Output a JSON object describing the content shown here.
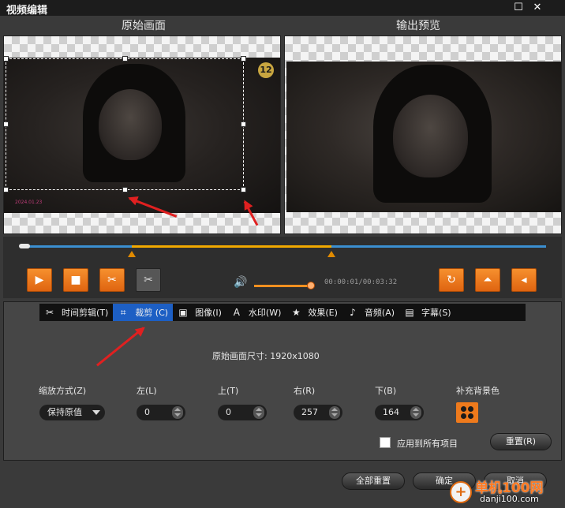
{
  "window": {
    "title": "视频编辑",
    "controls": {
      "maximize": "☐",
      "close": "✕"
    }
  },
  "viewers": {
    "source_label": "原始画面",
    "output_label": "输出预览",
    "badge_text": "12",
    "watermark_text": "2024.01.23"
  },
  "playback": {
    "time_display": "00:00:01/00:03:32",
    "volume_fraction": 0.95,
    "position_fraction": 0.0,
    "segment_start_fraction": 0.21,
    "segment_end_fraction": 0.59,
    "icons": {
      "play": "▶",
      "stop": "■",
      "cut": "✂",
      "cut_disabled": "✂",
      "rotate": "↻",
      "flip_horizontal": "⏶",
      "flip_vertical": "◂",
      "volume": "🔊"
    }
  },
  "tabs": [
    {
      "icon": "✂",
      "label": "时间剪辑(T)",
      "active": false
    },
    {
      "icon": "⌗",
      "label": "裁剪 (C)",
      "active": true
    },
    {
      "icon": "▣",
      "label": "图像(I)",
      "active": false
    },
    {
      "icon": "A",
      "label": "水印(W)",
      "active": false
    },
    {
      "icon": "★",
      "label": "效果(E)",
      "active": false
    },
    {
      "icon": "♪",
      "label": "音频(A)",
      "active": false
    },
    {
      "icon": "▤",
      "label": "字幕(S)",
      "active": false
    }
  ],
  "crop": {
    "original_size_text": "原始画面尺寸: 1920x1080",
    "scale_label": "缩放方式(Z)",
    "scale_value": "保持原值",
    "left_label": "左(L)",
    "left_value": "0",
    "top_label": "上(T)",
    "top_value": "0",
    "right_label": "右(R)",
    "right_value": "257",
    "bottom_label": "下(B)",
    "bottom_value": "164",
    "fill_color_label": "补充背景色",
    "apply_all_label": "应用到所有项目",
    "apply_all_checked": false,
    "reset_label": "重置(R)"
  },
  "footer": {
    "reset_all_label": "全部重置",
    "ok_label": "确定",
    "cancel_label": "取消"
  },
  "watermark_site": {
    "name": "单机100网",
    "url": "danji100.com",
    "logo_glyph": "+"
  },
  "colors": {
    "accent_orange": "#f29020",
    "timeline_blue": "#3b8fd1",
    "active_tab_blue": "#1d5fc4",
    "annotation_red": "#e02020"
  }
}
